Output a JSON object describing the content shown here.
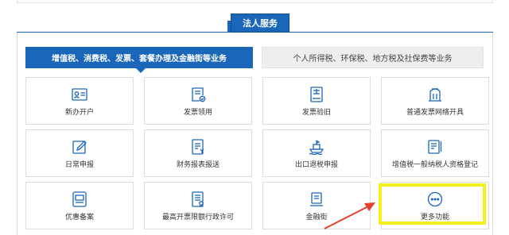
{
  "header": {
    "title": "法人服务"
  },
  "tabs": [
    {
      "label": "增值税、消费税、发票、套餐办理及金融街等业务",
      "active": true
    },
    {
      "label": "个人所得税、环保税、地方税及社保费等业务",
      "active": false
    }
  ],
  "services": [
    {
      "label": "新办开户",
      "icon": "id-card-icon"
    },
    {
      "label": "发票领用",
      "icon": "invoice-receive-icon"
    },
    {
      "label": "发票验旧",
      "icon": "invoice-verify-icon"
    },
    {
      "label": "普通发票网络开具",
      "icon": "online-invoice-icon"
    },
    {
      "label": "日常申报",
      "icon": "edit-declare-icon"
    },
    {
      "label": "财务报表报送",
      "icon": "financial-report-icon"
    },
    {
      "label": "出口退税申报",
      "icon": "export-ship-icon"
    },
    {
      "label": "增值税一般纳税人资格登记",
      "icon": "taxpayer-register-icon"
    },
    {
      "label": "优惠备案",
      "icon": "preferential-filing-icon"
    },
    {
      "label": "最高开票限额行政许可",
      "icon": "invoice-limit-icon"
    },
    {
      "label": "金融街",
      "icon": "finance-street-icon"
    },
    {
      "label": "更多功能",
      "icon": "more-icon"
    }
  ],
  "colors": {
    "primary": "#1a66b8",
    "highlight": "#f6f11b",
    "arrow": "#e8402b"
  }
}
